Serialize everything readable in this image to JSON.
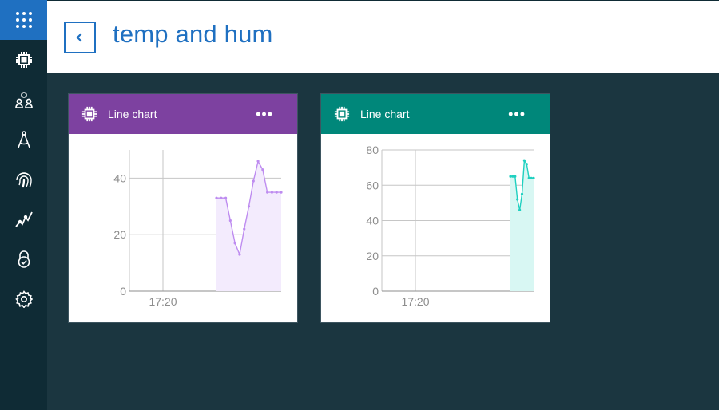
{
  "page": {
    "title": "temp and hum"
  },
  "sidebar": {
    "items": [
      {
        "icon": "grid-icon",
        "active": true
      },
      {
        "icon": "chip-icon"
      },
      {
        "icon": "users-icon"
      },
      {
        "icon": "compass-icon"
      },
      {
        "icon": "fingerprint-icon"
      },
      {
        "icon": "activity-icon"
      },
      {
        "icon": "lock-check-icon"
      },
      {
        "icon": "gear-icon"
      }
    ]
  },
  "colors": {
    "accent": "#1f70c1",
    "card1": "#7d41a0",
    "card2": "#00877a",
    "series1": "#be8cf0",
    "series2": "#1fd0c0"
  },
  "cards": [
    {
      "title": "Line chart",
      "menu": "•••",
      "chart_data": {
        "type": "line",
        "title": "",
        "xlabel": "",
        "ylabel": "",
        "ylim": [
          0,
          50
        ],
        "yticks": [
          "0",
          "20",
          "40"
        ],
        "xticks": [
          "17:20"
        ],
        "series": [
          {
            "values": [
              33,
              33,
              33,
              25,
              17,
              13,
              22,
              30,
              39,
              46,
              43,
              35,
              35,
              35,
              35
            ]
          }
        ]
      }
    },
    {
      "title": "Line chart",
      "menu": "•••",
      "chart_data": {
        "type": "line",
        "title": "",
        "xlabel": "",
        "ylabel": "",
        "ylim": [
          0,
          80
        ],
        "yticks": [
          "0",
          "20",
          "40",
          "60",
          "80"
        ],
        "xticks": [
          "17:20"
        ],
        "series": [
          {
            "values": [
              65,
              65,
              65,
              52,
              46,
              55,
              74,
              72,
              64,
              64,
              64
            ]
          }
        ]
      }
    }
  ]
}
